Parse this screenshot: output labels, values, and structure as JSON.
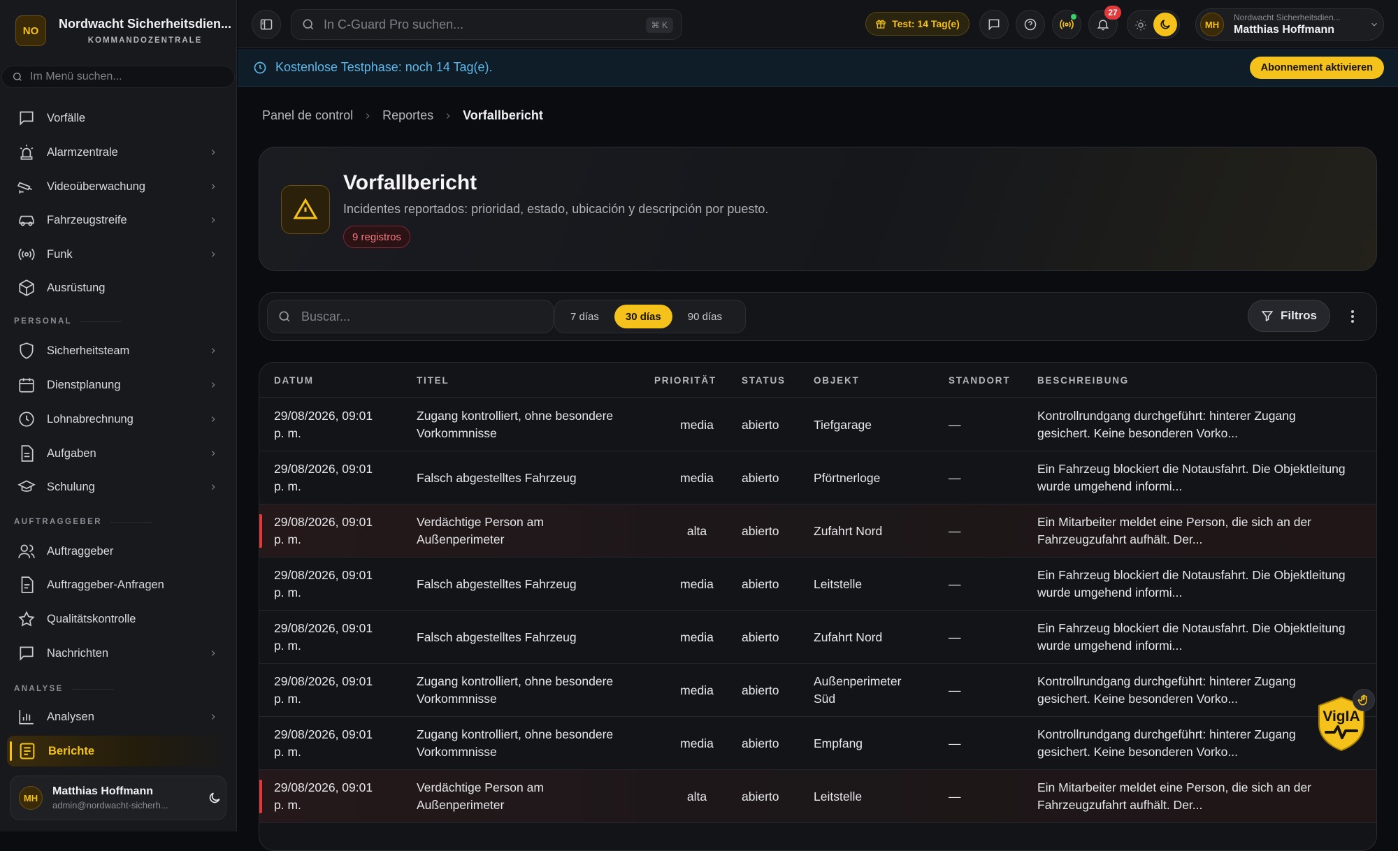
{
  "brand": {
    "initials": "NO",
    "name": "Nordwacht Sicherheitsdien...",
    "subtitle": "KOMMANDOZENTRALE"
  },
  "sidebar_search": {
    "placeholder": "Im Menü suchen..."
  },
  "nav": {
    "items_top": [
      {
        "label": "Vorfälle",
        "icon": "message-square-icon",
        "chevron": false
      },
      {
        "label": "Alarmzentrale",
        "icon": "siren-icon",
        "chevron": true
      },
      {
        "label": "Videoüberwachung",
        "icon": "cctv-icon",
        "chevron": true
      },
      {
        "label": "Fahrzeugstreife",
        "icon": "car-icon",
        "chevron": true
      },
      {
        "label": "Funk",
        "icon": "radio-icon",
        "chevron": true
      },
      {
        "label": "Ausrüstung",
        "icon": "package-icon",
        "chevron": false
      }
    ],
    "section_personal": "PERSONAL",
    "items_personal": [
      {
        "label": "Sicherheitsteam",
        "icon": "shield-icon",
        "chevron": true
      },
      {
        "label": "Dienstplanung",
        "icon": "calendar-icon",
        "chevron": true
      },
      {
        "label": "Lohnabrechnung",
        "icon": "clock-icon",
        "chevron": true
      },
      {
        "label": "Aufgaben",
        "icon": "file-text-icon",
        "chevron": true
      },
      {
        "label": "Schulung",
        "icon": "graduation-cap-icon",
        "chevron": true
      }
    ],
    "section_clients": "AUFTRAGGEBER",
    "items_clients": [
      {
        "label": "Auftraggeber",
        "icon": "users-icon",
        "chevron": false
      },
      {
        "label": "Auftraggeber-Anfragen",
        "icon": "file-icon",
        "chevron": false
      },
      {
        "label": "Qualitätskontrolle",
        "icon": "star-icon",
        "chevron": false
      },
      {
        "label": "Nachrichten",
        "icon": "chat-icon",
        "chevron": true
      }
    ],
    "section_analysis": "ANALYSE",
    "items_analysis": [
      {
        "label": "Analysen",
        "icon": "bar-chart-icon",
        "chevron": true
      },
      {
        "label": "Berichte",
        "icon": "report-icon",
        "chevron": false,
        "active": true
      }
    ]
  },
  "user": {
    "initials": "MH",
    "name": "Matthias Hoffmann",
    "email": "admin@nordwacht-sicherh...",
    "org": "Nordwacht Sicherheitsdien..."
  },
  "topbar": {
    "search_placeholder": "In C-Guard Pro suchen...",
    "shortcut": "⌘ K",
    "trial": "Test: 14 Tag(e)",
    "notifications": "27"
  },
  "banner": {
    "text": "Kostenlose Testphase: noch 14 Tag(e).",
    "button": "Abonnement aktivieren"
  },
  "breadcrumbs": [
    "Panel de control",
    "Reportes",
    "Vorfallbericht"
  ],
  "page": {
    "title": "Vorfallbericht",
    "subtitle": "Incidentes reportados: prioridad, estado, ubicación y descripción por puesto.",
    "count": "9 registros"
  },
  "toolbar": {
    "search_placeholder": "Buscar...",
    "ranges": [
      "7 días",
      "30 días",
      "90 días"
    ],
    "active_range": "30 días",
    "filter": "Filtros"
  },
  "table": {
    "columns": [
      "DATUM",
      "TITEL",
      "PRIORITÄT",
      "STATUS",
      "OBJEKT",
      "STANDORT",
      "BESCHREIBUNG"
    ],
    "rows": [
      {
        "date1": "29/08/2026, 09:01",
        "date2": "p. m.",
        "title1": "Zugang kontrolliert, ohne besondere",
        "title2": "Vorkommnisse",
        "priority": "media",
        "status": "abierto",
        "object1": "Tiefgarage",
        "object2": "",
        "location": "—",
        "desc1": "Kontrollrundgang durchgeführt: hinterer Zugang",
        "desc2": "gesichert. Keine besonderen Vorko...",
        "high": false
      },
      {
        "date1": "29/08/2026, 09:01",
        "date2": "p. m.",
        "title1": "Falsch abgestelltes Fahrzeug",
        "title2": "",
        "priority": "media",
        "status": "abierto",
        "object1": "Pförtnerloge",
        "object2": "",
        "location": "—",
        "desc1": "Ein Fahrzeug blockiert die Notausfahrt. Die Objektleitung",
        "desc2": "wurde umgehend informi...",
        "high": false
      },
      {
        "date1": "29/08/2026, 09:01",
        "date2": "p. m.",
        "title1": "Verdächtige Person am",
        "title2": "Außenperimeter",
        "priority": "alta",
        "status": "abierto",
        "object1": "Zufahrt Nord",
        "object2": "",
        "location": "—",
        "desc1": "Ein Mitarbeiter meldet eine Person, die sich an der",
        "desc2": "Fahrzeugzufahrt aufhält. Der...",
        "high": true
      },
      {
        "date1": "29/08/2026, 09:01",
        "date2": "p. m.",
        "title1": "Falsch abgestelltes Fahrzeug",
        "title2": "",
        "priority": "media",
        "status": "abierto",
        "object1": "Leitstelle",
        "object2": "",
        "location": "—",
        "desc1": "Ein Fahrzeug blockiert die Notausfahrt. Die Objektleitung",
        "desc2": "wurde umgehend informi...",
        "high": false
      },
      {
        "date1": "29/08/2026, 09:01",
        "date2": "p. m.",
        "title1": "Falsch abgestelltes Fahrzeug",
        "title2": "",
        "priority": "media",
        "status": "abierto",
        "object1": "Zufahrt Nord",
        "object2": "",
        "location": "—",
        "desc1": "Ein Fahrzeug blockiert die Notausfahrt. Die Objektleitung",
        "desc2": "wurde umgehend informi...",
        "high": false
      },
      {
        "date1": "29/08/2026, 09:01",
        "date2": "p. m.",
        "title1": "Zugang kontrolliert, ohne besondere",
        "title2": "Vorkommnisse",
        "priority": "media",
        "status": "abierto",
        "object1": "Außenperimeter",
        "object2": "Süd",
        "location": "—",
        "desc1": "Kontrollrundgang durchgeführt: hinterer Zugang",
        "desc2": "gesichert. Keine besonderen Vorko...",
        "high": false
      },
      {
        "date1": "29/08/2026, 09:01",
        "date2": "p. m.",
        "title1": "Zugang kontrolliert, ohne besondere",
        "title2": "Vorkommnisse",
        "priority": "media",
        "status": "abierto",
        "object1": "Empfang",
        "object2": "",
        "location": "—",
        "desc1": "Kontrollrundgang durchgeführt: hinterer Zugang",
        "desc2": "gesichert. Keine besonderen Vorko...",
        "high": false
      },
      {
        "date1": "29/08/2026, 09:01",
        "date2": "p. m.",
        "title1": "Verdächtige Person am",
        "title2": "Außenperimeter",
        "priority": "alta",
        "status": "abierto",
        "object1": "Leitstelle",
        "object2": "",
        "location": "—",
        "desc1": "Ein Mitarbeiter meldet eine Person, die sich an der",
        "desc2": "Fahrzeugzufahrt aufhält. Der...",
        "high": true
      }
    ]
  },
  "assistant": {
    "label": "VigIA"
  },
  "colors": {
    "accent": "#f4c21a",
    "danger": "#e23a3a",
    "info": "#5fb6e8",
    "background": "#0b0c0f"
  }
}
